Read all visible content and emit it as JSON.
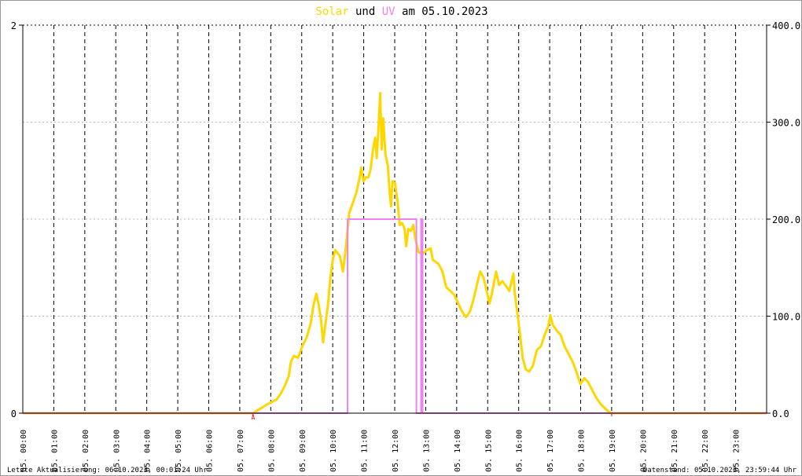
{
  "chart_data": {
    "type": "line",
    "title": {
      "part1": "Solar",
      "part2": "und",
      "part3": "UV",
      "part4": "am 05.10.2023"
    },
    "xlim": [
      0,
      24
    ],
    "x_tick_labels": [
      "05. 00:00",
      "05. 01:00",
      "05. 02:00",
      "05. 03:00",
      "05. 04:00",
      "05. 05:00",
      "05. 06:00",
      "05. 07:00",
      "05. 08:00",
      "05. 09:00",
      "05. 10:00",
      "05. 11:00",
      "05. 12:00",
      "05. 13:00",
      "05. 14:00",
      "05. 15:00",
      "05. 16:00",
      "05. 17:00",
      "05. 18:00",
      "05. 19:00",
      "05. 20:00",
      "05. 21:00",
      "05. 22:00",
      "05. 23:00"
    ],
    "left_axis": {
      "ylim": [
        0,
        2
      ],
      "ticks": [
        0,
        2
      ],
      "tick_labels": [
        "0",
        "2"
      ]
    },
    "right_axis": {
      "ylim": [
        0,
        400
      ],
      "ticks": [
        0,
        100,
        200,
        300,
        400
      ],
      "tick_labels": [
        "0.0",
        "100.0",
        "200.0",
        "300.0",
        "400.0"
      ]
    },
    "grid": true,
    "markers": [
      {
        "label": "A",
        "x": 7.43
      },
      {
        "label": "",
        "x": 19.0
      }
    ],
    "series": [
      {
        "name": "Solar",
        "axis": "right",
        "color": "#FFD700",
        "points": [
          [
            0,
            0
          ],
          [
            7.18,
            0
          ],
          [
            7.43,
            0
          ],
          [
            7.68,
            5
          ],
          [
            7.94,
            10
          ],
          [
            8.19,
            14
          ],
          [
            8.32,
            20
          ],
          [
            8.45,
            28
          ],
          [
            8.58,
            38
          ],
          [
            8.65,
            53
          ],
          [
            8.75,
            59
          ],
          [
            8.88,
            57
          ],
          [
            8.96,
            64
          ],
          [
            9.03,
            70
          ],
          [
            9.16,
            78
          ],
          [
            9.29,
            93
          ],
          [
            9.39,
            113
          ],
          [
            9.47,
            123
          ],
          [
            9.54,
            113
          ],
          [
            9.62,
            97
          ],
          [
            9.69,
            73
          ],
          [
            9.77,
            93
          ],
          [
            9.85,
            113
          ],
          [
            9.92,
            138
          ],
          [
            10.0,
            158
          ],
          [
            10.08,
            168
          ],
          [
            10.23,
            162
          ],
          [
            10.33,
            146
          ],
          [
            10.41,
            166
          ],
          [
            10.53,
            206
          ],
          [
            10.64,
            216
          ],
          [
            10.76,
            227
          ],
          [
            10.87,
            243
          ],
          [
            10.92,
            253
          ],
          [
            10.99,
            239
          ],
          [
            11.07,
            243
          ],
          [
            11.15,
            243
          ],
          [
            11.22,
            251
          ],
          [
            11.3,
            272
          ],
          [
            11.37,
            284
          ],
          [
            11.42,
            263
          ],
          [
            11.48,
            296
          ],
          [
            11.53,
            330
          ],
          [
            11.58,
            272
          ],
          [
            11.63,
            304
          ],
          [
            11.7,
            267
          ],
          [
            11.78,
            255
          ],
          [
            11.83,
            231
          ],
          [
            11.88,
            213
          ],
          [
            11.93,
            239
          ],
          [
            12.01,
            237
          ],
          [
            12.09,
            219
          ],
          [
            12.16,
            194
          ],
          [
            12.24,
            196
          ],
          [
            12.32,
            190
          ],
          [
            12.37,
            172
          ],
          [
            12.44,
            190
          ],
          [
            12.52,
            188
          ],
          [
            12.6,
            194
          ],
          [
            12.65,
            182
          ],
          [
            12.77,
            166
          ],
          [
            12.9,
            164
          ],
          [
            13.03,
            168
          ],
          [
            13.16,
            170
          ],
          [
            13.23,
            158
          ],
          [
            13.41,
            154
          ],
          [
            13.54,
            146
          ],
          [
            13.66,
            130
          ],
          [
            13.79,
            126
          ],
          [
            13.92,
            122
          ],
          [
            14.05,
            113
          ],
          [
            14.17,
            105
          ],
          [
            14.3,
            99
          ],
          [
            14.43,
            105
          ],
          [
            14.55,
            118
          ],
          [
            14.68,
            136
          ],
          [
            14.76,
            146
          ],
          [
            14.86,
            140
          ],
          [
            14.94,
            130
          ],
          [
            15.06,
            113
          ],
          [
            15.14,
            124
          ],
          [
            15.27,
            146
          ],
          [
            15.37,
            132
          ],
          [
            15.47,
            136
          ],
          [
            15.57,
            132
          ],
          [
            15.7,
            126
          ],
          [
            15.83,
            144
          ],
          [
            15.88,
            122
          ],
          [
            15.95,
            105
          ],
          [
            16.03,
            85
          ],
          [
            16.13,
            57
          ],
          [
            16.23,
            45
          ],
          [
            16.34,
            43
          ],
          [
            16.46,
            49
          ],
          [
            16.59,
            65
          ],
          [
            16.72,
            69
          ],
          [
            16.84,
            81
          ],
          [
            16.95,
            89
          ],
          [
            17.02,
            101
          ],
          [
            17.1,
            91
          ],
          [
            17.23,
            85
          ],
          [
            17.35,
            81
          ],
          [
            17.48,
            69
          ],
          [
            17.61,
            61
          ],
          [
            17.74,
            53
          ],
          [
            17.86,
            43
          ],
          [
            17.99,
            30
          ],
          [
            18.12,
            36
          ],
          [
            18.24,
            32
          ],
          [
            18.37,
            24
          ],
          [
            18.5,
            16
          ],
          [
            18.63,
            10
          ],
          [
            18.75,
            6
          ],
          [
            18.88,
            2
          ],
          [
            19.01,
            0
          ],
          [
            24,
            0
          ]
        ]
      },
      {
        "name": "UV",
        "axis": "left",
        "color": "#EE82EE",
        "step": true,
        "points": [
          [
            0,
            0
          ],
          [
            10.48,
            0
          ],
          [
            10.48,
            1
          ],
          [
            12.7,
            1
          ],
          [
            12.7,
            0
          ],
          [
            12.85,
            0
          ],
          [
            12.85,
            1
          ],
          [
            12.9,
            1
          ],
          [
            12.9,
            0
          ],
          [
            24,
            0
          ]
        ]
      }
    ]
  },
  "footer": {
    "left": "Letzte Aktualisierung: 06.10.2023, 00:01:24 Uhr",
    "right": "Datenstand: 05.10.2023, 23:59:44 Uhr"
  }
}
